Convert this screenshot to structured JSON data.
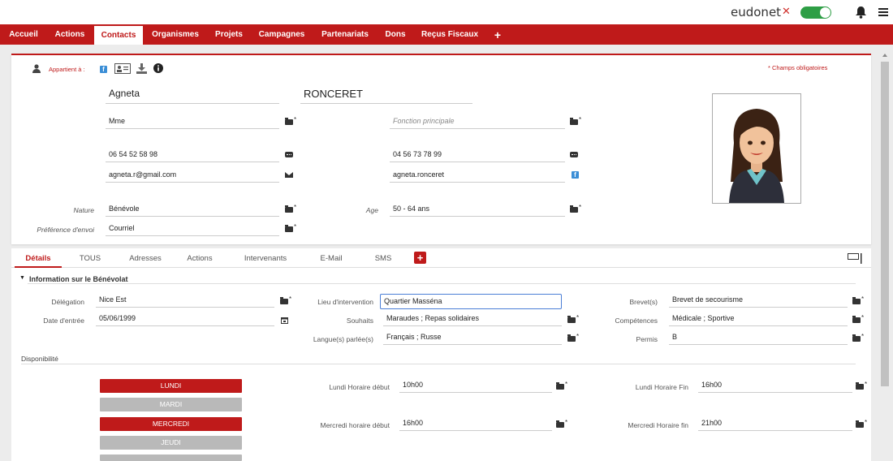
{
  "app": {
    "brand": "eudonet",
    "brand_mark": "✕"
  },
  "nav": {
    "items": [
      "Accueil",
      "Actions",
      "Contacts",
      "Organismes",
      "Projets",
      "Campagnes",
      "Partenariats",
      "Dons",
      "Reçus Fiscaux",
      "+"
    ],
    "active": "Contacts"
  },
  "header": {
    "appartient": "Appartient à :",
    "required": "* Champs obligatoires"
  },
  "contact": {
    "first_name": "Agneta",
    "last_name": "RONCERET",
    "civility": "Mme",
    "fonction_placeholder": "Fonction principale",
    "phone1": "06 54 52 58 98",
    "phone2": "04 56 73 78 99",
    "email": "agneta.r@gmail.com",
    "facebook": "agneta.ronceret",
    "nature_label": "Nature",
    "nature": "Bénévole",
    "age_label": "Age",
    "age": "50 - 64 ans",
    "pref_label": "Préférence d'envoi",
    "pref": "Courriel"
  },
  "tabs": {
    "items": [
      "Détails",
      "TOUS",
      "Adresses",
      "Actions",
      "Intervenants",
      "E-Mail",
      "SMS"
    ],
    "add": "+"
  },
  "section": {
    "title": "Information sur le Bénévolat"
  },
  "benevolat": {
    "delegation_label": "Délégation",
    "delegation": "Nice Est",
    "date_label": "Date d'entrée",
    "date": "05/06/1999",
    "lieu_label": "Lieu d'intervention",
    "lieu": "Quartier Masséna",
    "souhaits_label": "Souhaits",
    "souhaits": "Maraudes ; Repas solidaires",
    "langues_label": "Langue(s) parlée(s)",
    "langues": "Français ; Russe",
    "brevet_label": "Brevet(s)",
    "brevet": "Brevet de secourisme",
    "competences_label": "Compétences",
    "competences": "Médicale ; Sportive",
    "permis_label": "Permis",
    "permis": "B"
  },
  "disponibilite": {
    "title": "Disponibilité",
    "days": [
      {
        "name": "LUNDI",
        "on": true
      },
      {
        "name": "MARDI",
        "on": false
      },
      {
        "name": "MERCREDI",
        "on": true
      },
      {
        "name": "JEUDI",
        "on": false
      }
    ],
    "lundi_debut_label": "Lundi Horaire début",
    "lundi_debut": "10h00",
    "lundi_fin_label": "Lundi Horaire Fin",
    "lundi_fin": "16h00",
    "mercredi_debut_label": "Mercredi horaire début",
    "mercredi_debut": "16h00",
    "mercredi_fin_label": "Mercredi Horaire fin",
    "mercredi_fin": "21h00"
  },
  "colors": {
    "accent": "#bf1a1a",
    "toggle": "#2e9e45",
    "day_off": "#b9b9b9"
  }
}
